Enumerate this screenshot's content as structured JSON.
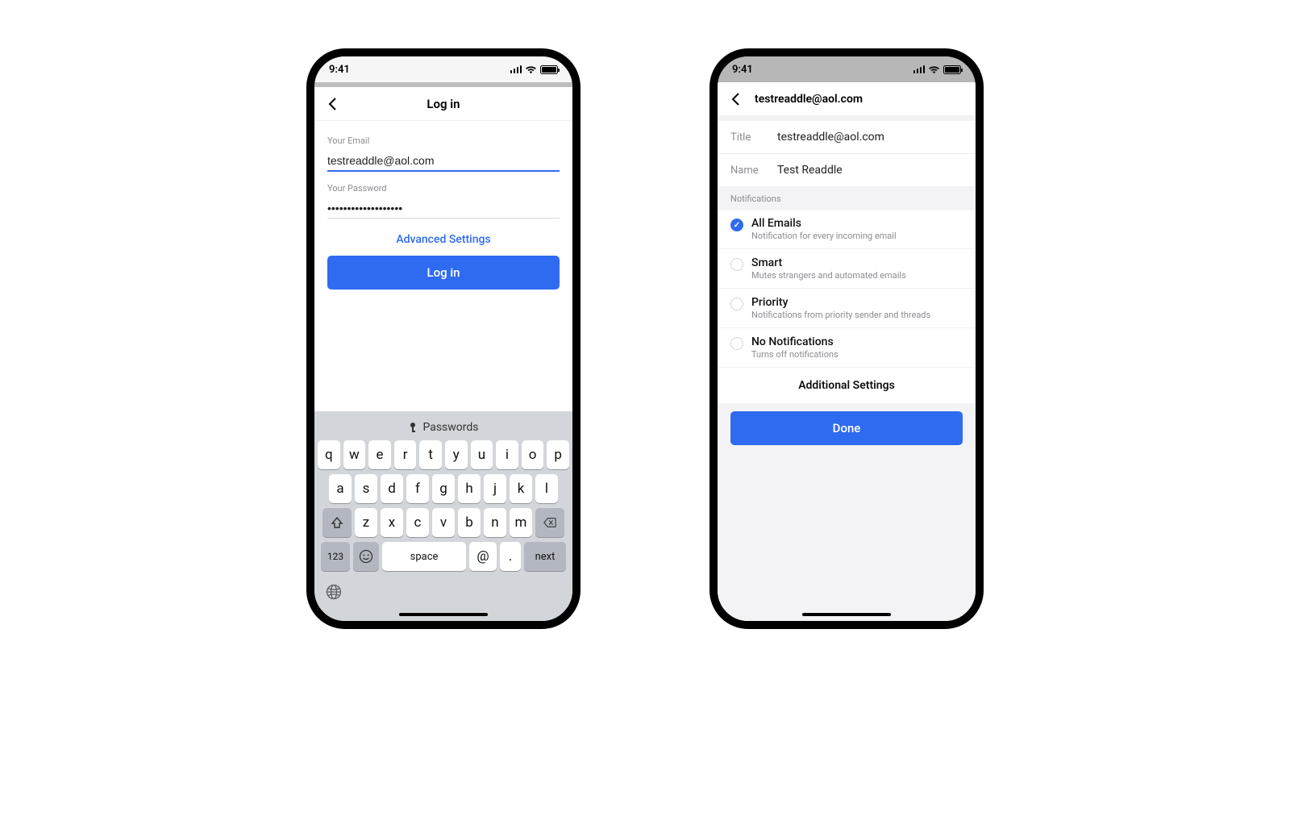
{
  "status": {
    "time": "9:41"
  },
  "left": {
    "nav_title": "Log in",
    "email_label": "Your Email",
    "email_value": "testreaddle@aol.com",
    "password_label": "Your Password",
    "password_value": "•••••••••••••••••••",
    "advanced": "Advanced Settings",
    "login_btn": "Log in",
    "keyboard": {
      "passwords": "Passwords",
      "row1": [
        "q",
        "w",
        "e",
        "r",
        "t",
        "y",
        "u",
        "i",
        "o",
        "p"
      ],
      "row2": [
        "a",
        "s",
        "d",
        "f",
        "g",
        "h",
        "j",
        "k",
        "l"
      ],
      "row3": [
        "z",
        "x",
        "c",
        "v",
        "b",
        "n",
        "m"
      ],
      "num": "123",
      "space": "space",
      "at": "@",
      "dot": ".",
      "next": "next"
    }
  },
  "right": {
    "nav_title": "testreaddle@aol.com",
    "title_label": "Title",
    "title_value": "testreaddle@aol.com",
    "name_label": "Name",
    "name_value": "Test Readdle",
    "section": "Notifications",
    "options": [
      {
        "title": "All Emails",
        "sub": "Notification for every incoming email",
        "checked": true
      },
      {
        "title": "Smart",
        "sub": "Mutes strangers and automated emails",
        "checked": false
      },
      {
        "title": "Priority",
        "sub": "Notifications from priority sender and threads",
        "checked": false
      },
      {
        "title": "No Notifications",
        "sub": "Turns off notifications",
        "checked": false
      }
    ],
    "additional": "Additional Settings",
    "done": "Done"
  }
}
